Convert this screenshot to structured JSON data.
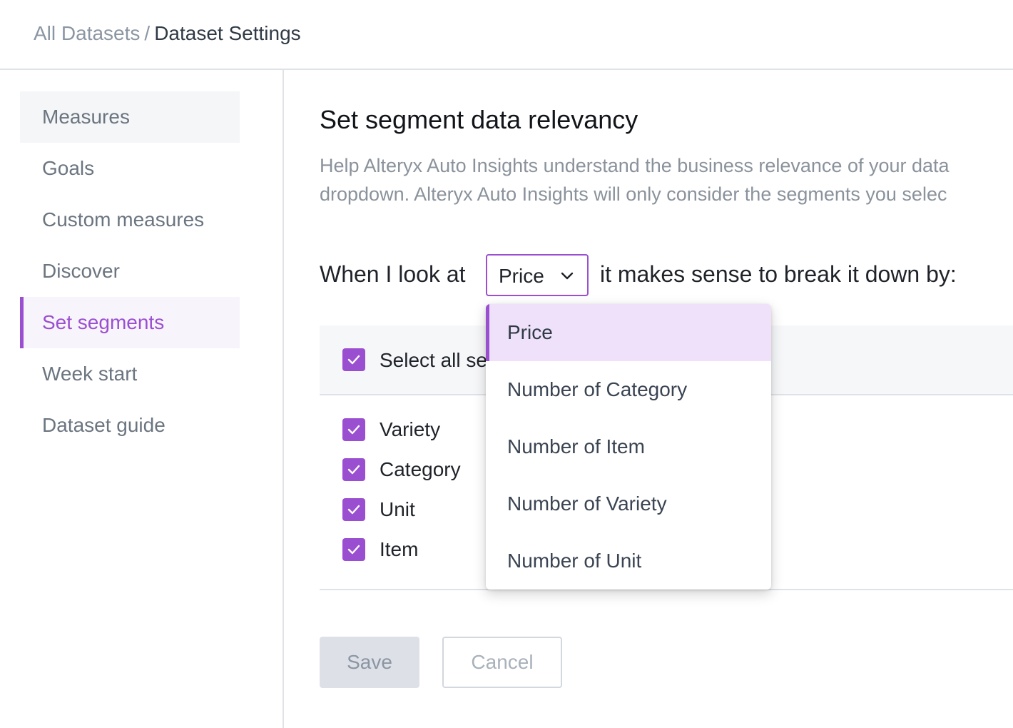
{
  "breadcrumb": {
    "parent": "All Datasets",
    "separator": "/",
    "current": "Dataset Settings"
  },
  "sidebar": {
    "items": [
      {
        "label": "Measures"
      },
      {
        "label": "Goals"
      },
      {
        "label": "Custom measures"
      },
      {
        "label": "Discover"
      },
      {
        "label": "Set segments",
        "active": true
      },
      {
        "label": "Week start"
      },
      {
        "label": "Dataset guide"
      }
    ]
  },
  "main": {
    "title": "Set segment data relevancy",
    "description_line1": "Help Alteryx Auto Insights understand the business relevance of your data",
    "description_line2": "dropdown. Alteryx Auto Insights will only consider the segments you selec",
    "sentence_prefix": "When I look at",
    "sentence_suffix": "it makes sense to break it down by:",
    "measure_select": {
      "value": "Price",
      "icon": "chevron-down-icon",
      "options": [
        "Price",
        "Number of Category",
        "Number of Item",
        "Number of Variety",
        "Number of Unit"
      ]
    },
    "select_all_label": "Select all se",
    "segments": [
      {
        "label": "Variety",
        "checked": true
      },
      {
        "label": "Category",
        "checked": true
      },
      {
        "label": "Unit",
        "checked": true
      },
      {
        "label": "Item",
        "checked": true
      }
    ],
    "save_label": "Save",
    "cancel_label": "Cancel"
  },
  "colors": {
    "accent": "#9a4fd0",
    "accent_bg": "#efe1fa",
    "muted_text": "#8a929b",
    "border": "#dfe3e8"
  }
}
